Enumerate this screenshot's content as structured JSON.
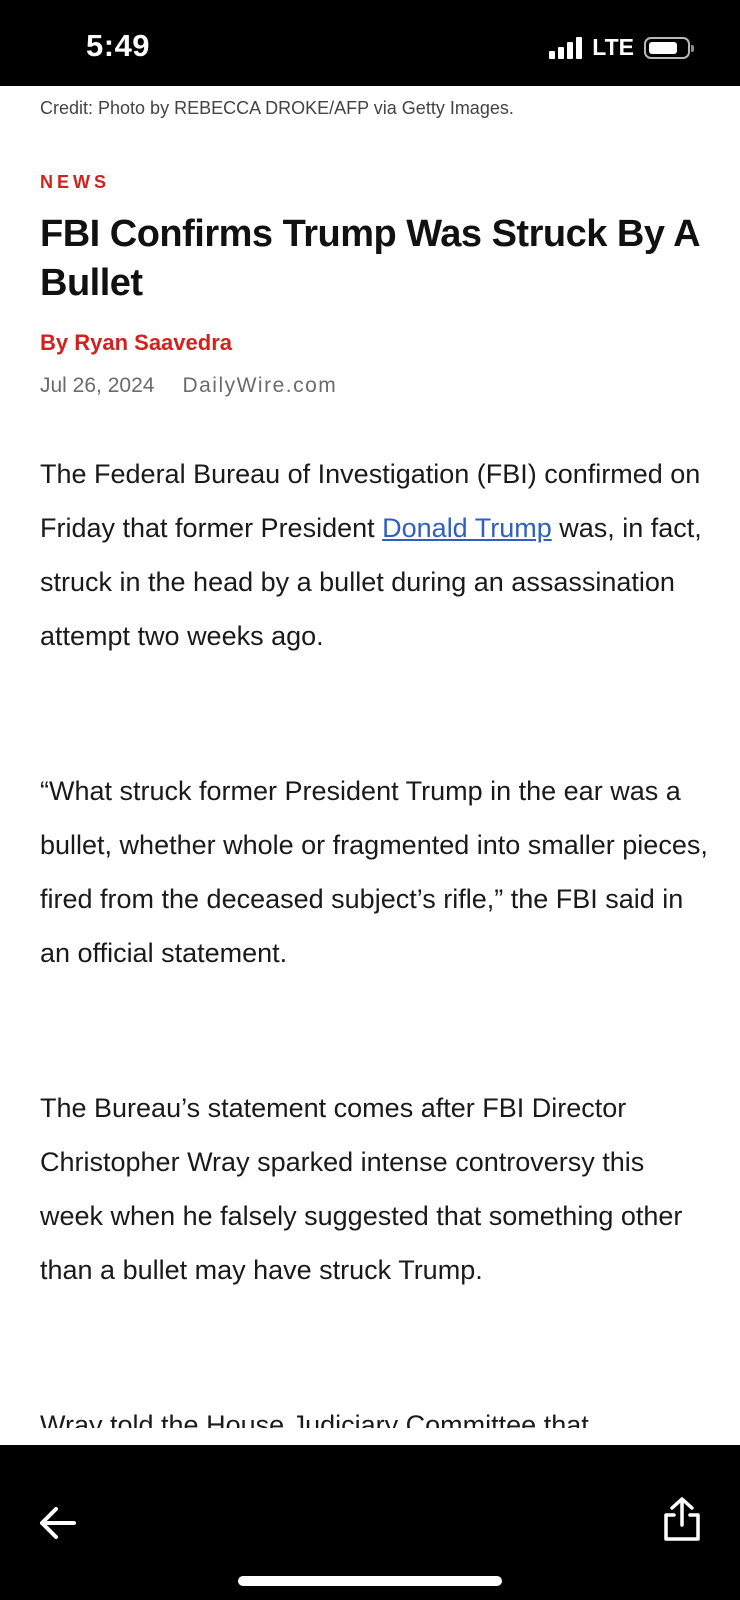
{
  "status_bar": {
    "time": "5:49",
    "network": "LTE"
  },
  "article": {
    "photo_credit": "Credit: Photo by REBECCA DROKE/AFP via Getty Images.",
    "section": "NEWS",
    "headline": "FBI Confirms Trump Was Struck By A Bullet",
    "byline": "By Ryan Saavedra",
    "date": "Jul 26, 2024",
    "source": "DailyWire.com",
    "paragraph1_before_link": "The Federal Bureau of Investigation (FBI) confirmed on Friday that former President ",
    "paragraph1_link": "Donald Trump",
    "paragraph1_after_link": " was, in fact, struck in the head by a bullet during an assassination attempt two weeks ago.",
    "paragraph2": "“What struck former President Trump in the ear was a bullet, whether whole or fragmented into smaller pieces, fired from the deceased subject’s rifle,” the FBI said in an official statement.",
    "paragraph3": "The Bureau’s statement comes after FBI Director Christopher Wray sparked intense controversy this week when he falsely suggested that something other than a bullet may have struck Trump.",
    "paragraph4_partial": "Wray told the House Judiciary Committee that"
  },
  "toolbar": {
    "back_icon": "arrow-left-icon",
    "share_icon": "share-icon"
  }
}
